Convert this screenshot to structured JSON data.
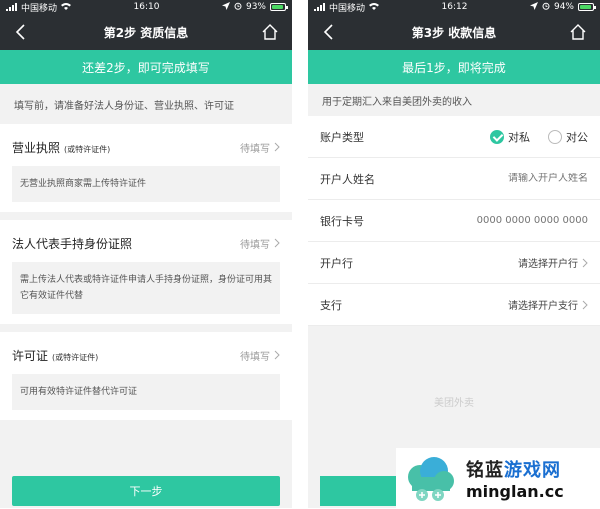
{
  "left": {
    "status": {
      "carrier": "中国移动",
      "time": "16:10",
      "battery": "93%",
      "battery_level": 0.93
    },
    "nav": {
      "title": "第2步 资质信息"
    },
    "banner": "还差2步，即可完成填写",
    "tip": "填写前，请准备好法人身份证、营业执照、许可证",
    "sections": [
      {
        "title": "营业执照",
        "note": "(或特许证件)",
        "status": "待填写",
        "desc": "无营业执照商家需上传特许证件"
      },
      {
        "title": "法人代表手持身份证照",
        "note": "",
        "status": "待填写",
        "desc": "需上传法人代表或特许证件申请人手持身份证照，身份证可用其它有效证件代替"
      },
      {
        "title": "许可证",
        "note": "(或特许证件)",
        "status": "待填写",
        "desc": "可用有效特许证件替代许可证"
      }
    ],
    "next_button": "下一步"
  },
  "right": {
    "status": {
      "carrier": "中国移动",
      "time": "16:12",
      "battery": "94%",
      "battery_level": 0.94
    },
    "nav": {
      "title": "第3步 收款信息"
    },
    "banner": "最后1步，即将完成",
    "tip": "用于定期汇入来自美团外卖的收入",
    "account_type": {
      "label": "账户类型",
      "options": [
        "对私",
        "对公"
      ],
      "selected": "对私"
    },
    "holder_name": {
      "label": "开户人姓名",
      "placeholder": "请输入开户人姓名"
    },
    "card_number": {
      "label": "银行卡号",
      "placeholder": "0000 0000 0000 0000"
    },
    "bank": {
      "label": "开户行",
      "value": "请选择开户行"
    },
    "branch": {
      "label": "支行",
      "value": "请选择开户支行"
    },
    "brand": "美团外卖"
  },
  "watermark": {
    "cn_part1": "铭蓝",
    "cn_part2": "游戏网",
    "en": "minglan.cc"
  },
  "colors": {
    "accent": "#2ec7a1",
    "dark_bar": "#2b2f33"
  }
}
